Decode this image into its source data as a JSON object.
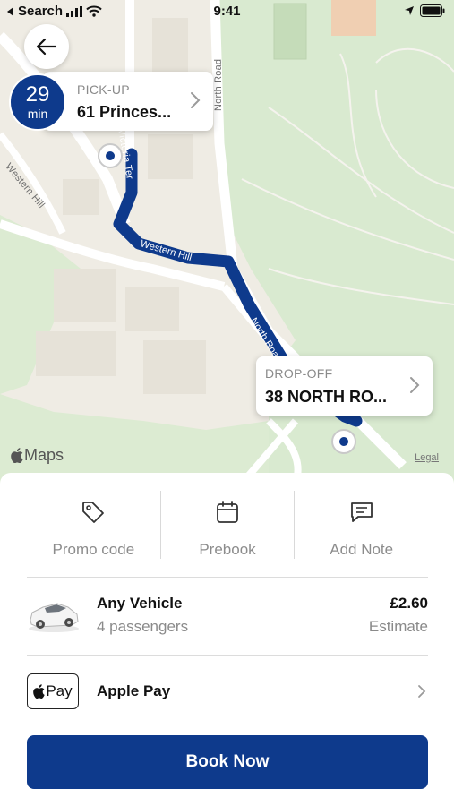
{
  "status_bar": {
    "back_label": "Search",
    "time": "9:41"
  },
  "map": {
    "roads": {
      "north_road": "North Road",
      "western_hill_left": "Western Hill",
      "victoria_ter": "Victoria Ter",
      "western_hill_route": "Western Hill",
      "north_road_route": "North Road"
    },
    "attribution": "Maps",
    "legal": "Legal"
  },
  "eta": {
    "value": "29",
    "unit": "min"
  },
  "pickup": {
    "label": "PICK-UP",
    "address": "61 Princes..."
  },
  "dropoff": {
    "label": "DROP-OFF",
    "address": "38 NORTH RO..."
  },
  "options": [
    {
      "label": "Promo code",
      "icon": "tag-icon"
    },
    {
      "label": "Prebook",
      "icon": "calendar-icon"
    },
    {
      "label": "Add Note",
      "icon": "note-icon"
    }
  ],
  "vehicle": {
    "name": "Any Vehicle",
    "passengers": "4 passengers",
    "price": "£2.60",
    "price_note": "Estimate"
  },
  "payment": {
    "badge": "Pay",
    "method": "Apple Pay"
  },
  "book_button": "Book Now",
  "colors": {
    "brand": "#0e3a8c",
    "route": "#0e3a8c",
    "park": "#d9ead0"
  }
}
